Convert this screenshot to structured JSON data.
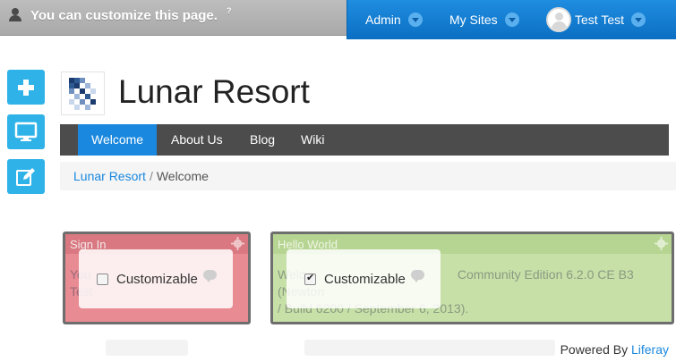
{
  "dockbar": {
    "message": "You can customize this page.",
    "help_mark": "?",
    "menu": [
      {
        "label": "Admin"
      },
      {
        "label": "My Sites"
      },
      {
        "label": "Test Test"
      }
    ]
  },
  "side_actions": [
    {
      "icon": "plus-icon"
    },
    {
      "icon": "monitor-icon"
    },
    {
      "icon": "edit-icon"
    }
  ],
  "site": {
    "title": "Lunar Resort"
  },
  "nav": {
    "items": [
      {
        "label": "Welcome",
        "active": true
      },
      {
        "label": "About Us"
      },
      {
        "label": "Blog"
      },
      {
        "label": "Wiki"
      }
    ]
  },
  "breadcrumb": {
    "home": "Lunar Resort",
    "separator": "/",
    "current": "Welcome"
  },
  "portlets": {
    "sign_in": {
      "title": "Sign In",
      "body_line1": "You",
      "body_line2": "Test",
      "customizable_label": "Customizable",
      "customizable_checked": false
    },
    "hello_world": {
      "title": "Hello World",
      "body_line1_prefix": "Welc",
      "body_line1_suffix": "Community Edition 6.2.0 CE B3 (Newton",
      "body_line2": "/ Build 6200 / September 6, 2013).",
      "customizable_label": "Customizable",
      "customizable_checked": true
    }
  },
  "footer": {
    "powered_by": "Powered By",
    "powered_link": "Liferay"
  },
  "colors": {
    "accent": "#1a88de",
    "side_button": "#2fb2e8",
    "nav_bg": "#4c4c4c",
    "portlet_red": "#e88b92",
    "portlet_green": "#c7e0a8"
  }
}
